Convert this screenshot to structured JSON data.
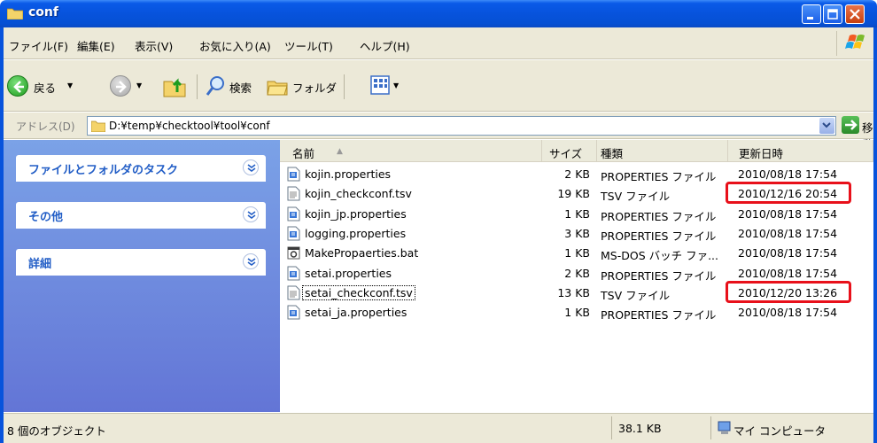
{
  "window": {
    "title": "conf"
  },
  "menu": [
    "ファイル(F)",
    "編集(E)",
    "表示(V)",
    "お気に入り(A)",
    "ツール(T)",
    "ヘルプ(H)"
  ],
  "toolbar": {
    "back_label": "戻る",
    "search_label": "検索",
    "folders_label": "フォルダ"
  },
  "address": {
    "label": "アドレス(D)",
    "path": "D:¥temp¥checktool¥tool¥conf",
    "go_label": "移動"
  },
  "taskpane": {
    "groups": [
      {
        "title": "ファイルとフォルダのタスク"
      },
      {
        "title": "その他"
      },
      {
        "title": "詳細"
      }
    ]
  },
  "columns": {
    "name": "名前",
    "size": "サイズ",
    "type": "種類",
    "modified": "更新日時"
  },
  "files": [
    {
      "name": "kojin.properties",
      "size": "2 KB",
      "type": "PROPERTIES ファイル",
      "modified": "2010/08/18 17:54",
      "icon": "properties-file-icon"
    },
    {
      "name": "kojin_checkconf.tsv",
      "size": "19 KB",
      "type": "TSV ファイル",
      "modified": "2010/12/16 20:54",
      "icon": "text-file-icon",
      "highlight": true
    },
    {
      "name": "kojin_jp.properties",
      "size": "1 KB",
      "type": "PROPERTIES ファイル",
      "modified": "2010/08/18 17:54",
      "icon": "properties-file-icon"
    },
    {
      "name": "logging.properties",
      "size": "3 KB",
      "type": "PROPERTIES ファイル",
      "modified": "2010/08/18 17:54",
      "icon": "properties-file-icon"
    },
    {
      "name": "MakePropaerties.bat",
      "size": "1 KB",
      "type": "MS-DOS バッチ ファ...",
      "modified": "2010/08/18 17:54",
      "icon": "batch-file-icon"
    },
    {
      "name": "setai.properties",
      "size": "2 KB",
      "type": "PROPERTIES ファイル",
      "modified": "2010/08/18 17:54",
      "icon": "properties-file-icon"
    },
    {
      "name": "setai_checkconf.tsv",
      "size": "13 KB",
      "type": "TSV ファイル",
      "modified": "2010/12/20 13:26",
      "icon": "text-file-icon",
      "highlight": true,
      "focused": true
    },
    {
      "name": "setai_ja.properties",
      "size": "1 KB",
      "type": "PROPERTIES ファイル",
      "modified": "2010/08/18 17:54",
      "icon": "properties-file-icon"
    }
  ],
  "status": {
    "count": "8 個のオブジェクト",
    "size": "38.1 KB",
    "location": "マイ コンピュータ"
  },
  "colors": {
    "titlebar": "#0753dc",
    "taskpane": "#6f8ede",
    "highlight": "#e8101a",
    "chrome": "#ece9d8"
  }
}
